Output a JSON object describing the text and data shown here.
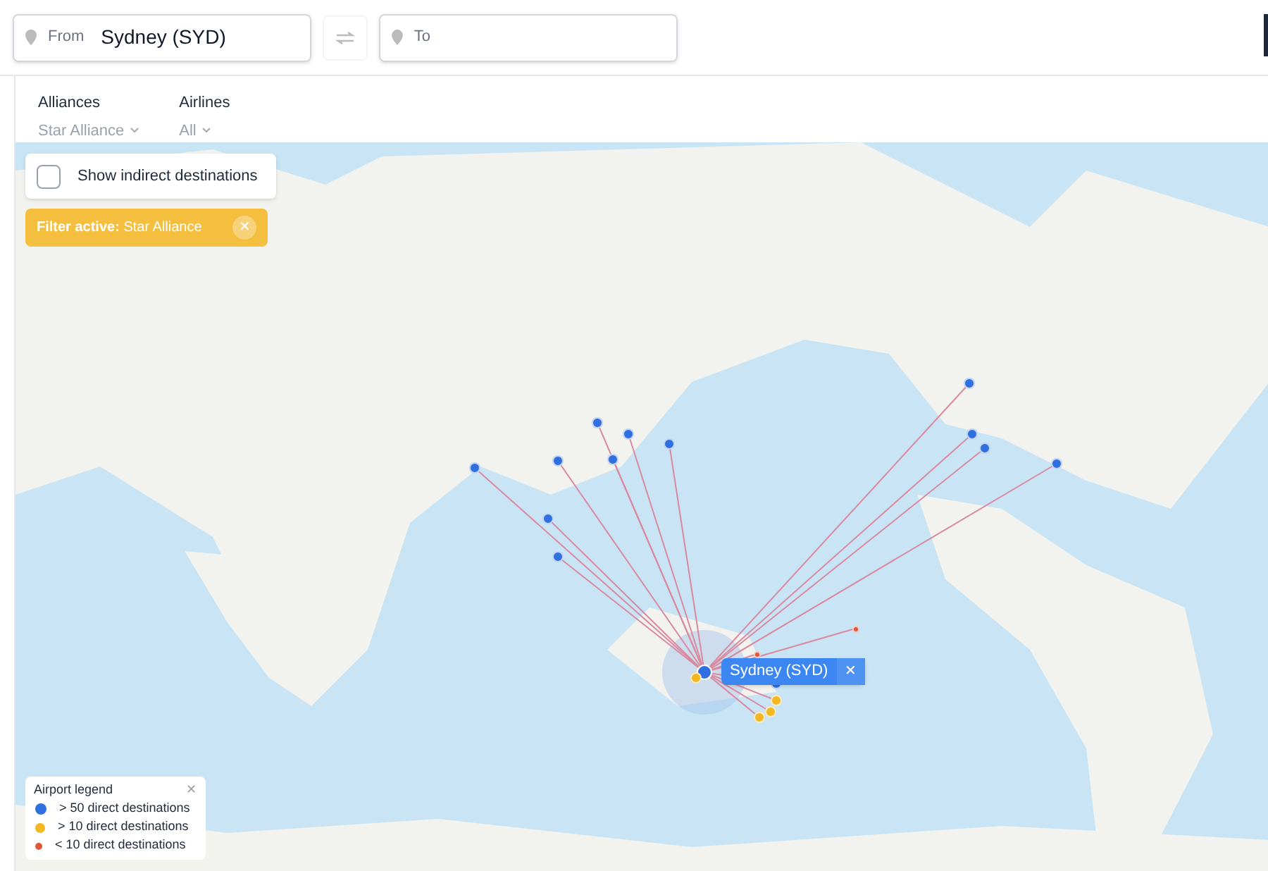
{
  "search": {
    "from": {
      "label": "From",
      "value": "Sydney (SYD)"
    },
    "to": {
      "placeholder": "To"
    }
  },
  "filters": [
    {
      "label": "Alliances",
      "value": "Star Alliance"
    },
    {
      "label": "Airlines",
      "value": "All"
    }
  ],
  "indirect": {
    "label": "Show indirect destinations",
    "checked": false
  },
  "filter_banner": {
    "text": "**Filter active:** Star Alliance",
    "close": "✕"
  },
  "origin_popup": {
    "label": "Sydney (SYD)",
    "close": "✕"
  },
  "airports": [
    {
      "color": "#2f6fe0"
    },
    {
      "color": "#2f6fe0"
    },
    {
      "color": "#2f6fe0"
    },
    {
      "color": "#2f6fe0"
    },
    {
      "color": "#2f6fe0"
    },
    {
      "color": "#2f6fe0"
    },
    {
      "color": "#2f6fe0"
    },
    {
      "color": "#2f6fe0"
    },
    {
      "color": "#2f6fe0"
    },
    {
      "color": "#2f6fe0"
    },
    {
      "color": "#2f6fe0"
    },
    {
      "color": "#2f6fe0"
    },
    {
      "color": "#2f6fe0"
    },
    {
      "color": "#f2b824"
    },
    {
      "color": "#f2b824"
    },
    {
      "color": "#f2b824"
    },
    {
      "color": "#f2b824"
    },
    {
      "color": "#e0583a"
    },
    {
      "color": "#e0583a"
    }
  ],
  "legend": {
    "title": "Airport legend",
    "close": "✕",
    "items": [
      {
        "label": "> 50 direct destinations",
        "color": "#2f6fe0"
      },
      {
        "label": "> 10 direct destinations",
        "color": "#f2b824"
      },
      {
        "label": "< 10 direct destinations",
        "color": "#e0583a"
      }
    ]
  }
}
